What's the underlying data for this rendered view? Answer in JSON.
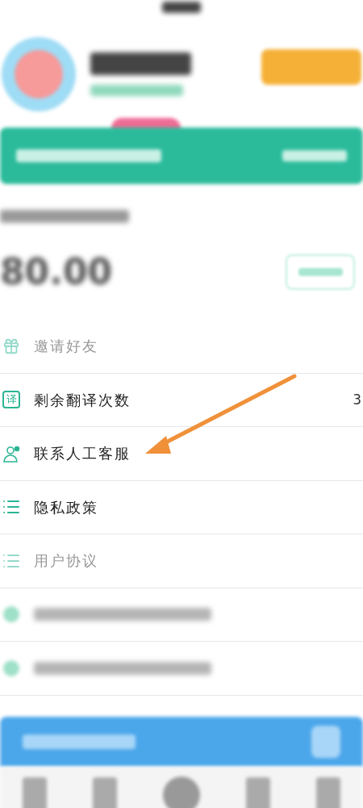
{
  "balance": {
    "amount": "80.00"
  },
  "menu": [
    {
      "kind": "gift",
      "label": "邀请好友",
      "faded": true
    },
    {
      "kind": "translate",
      "icon_text": "译",
      "label": "剩余翻译次数",
      "value": "3",
      "faded": false
    },
    {
      "kind": "agent",
      "label": "联系人工客服",
      "faded": false
    },
    {
      "kind": "list",
      "label": "隐私政策",
      "faded": false
    },
    {
      "kind": "list",
      "label": "用户协议",
      "faded": true
    },
    {
      "kind": "redacted"
    },
    {
      "kind": "redacted"
    }
  ]
}
